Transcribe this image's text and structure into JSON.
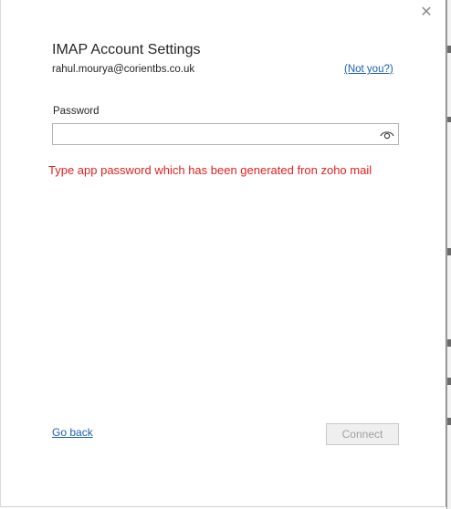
{
  "dialog": {
    "close_glyph": "✕",
    "title": "IMAP Account Settings",
    "email": "rahul.mourya@corientbs.co.uk",
    "not_you_link": "(Not you?)",
    "password_label": "Password",
    "password_value": "",
    "password_reveal_icon": "eye-icon",
    "annotation": "Type app password which has been generated fron zoho mail",
    "go_back_link": "Go back",
    "connect_button": "Connect",
    "connect_enabled": false
  },
  "colors": {
    "link": "#1a5fb4",
    "annotation": "#e02020",
    "text": "#262626",
    "disabled_button_bg": "#efefef",
    "disabled_button_text": "#a0a0a0"
  }
}
